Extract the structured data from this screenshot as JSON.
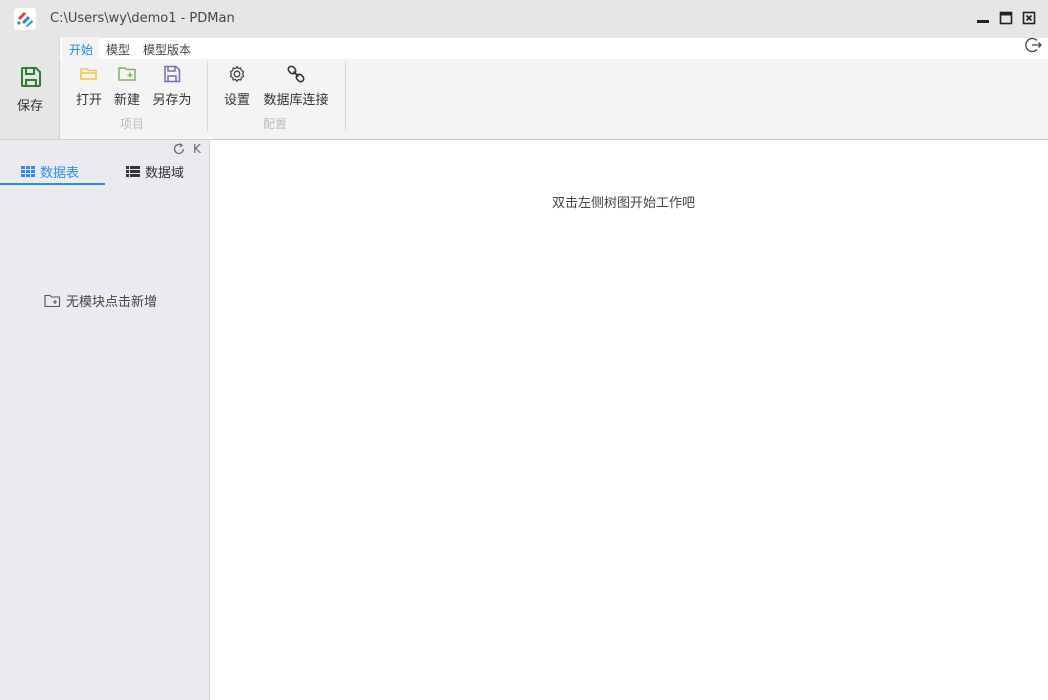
{
  "window": {
    "title": "C:\\Users\\wy\\demo1 - PDMan"
  },
  "ribbon": {
    "tabs": [
      {
        "label": "开始",
        "active": true
      },
      {
        "label": "模型",
        "active": false
      },
      {
        "label": "模型版本",
        "active": false
      }
    ],
    "save_label": "保存",
    "buttons": {
      "open": "打开",
      "new": "新建",
      "save_as": "另存为",
      "settings": "设置",
      "db_connect": "数据库连接"
    },
    "groups": {
      "project": "项目",
      "config": "配置"
    }
  },
  "left_panel": {
    "collapse_icon_text": "K",
    "tabs": [
      {
        "label": "数据表",
        "icon": "grid-icon",
        "active": true
      },
      {
        "label": "数据域",
        "icon": "list-icon",
        "active": false
      }
    ],
    "empty_text": "无模块点击新增"
  },
  "main": {
    "hint": "双击左侧树图开始工作吧"
  },
  "colors": {
    "accent": "#1e88e5",
    "save_icon": "#2e7d32",
    "open_icon": "#f5c342",
    "new_icon": "#7cb35b",
    "saveas_icon": "#7b6bbd"
  }
}
